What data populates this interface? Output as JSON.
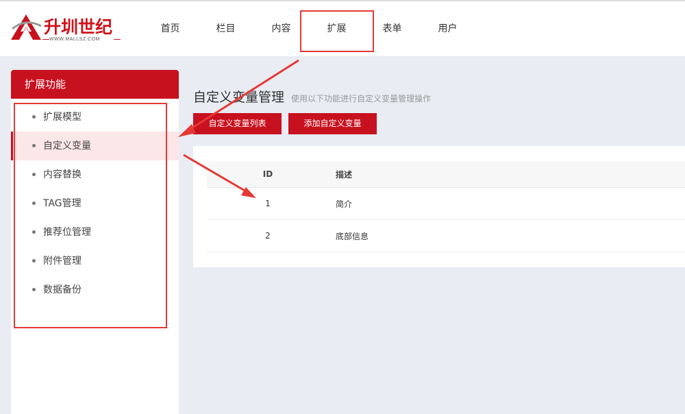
{
  "logo": {
    "title": "升圳世纪",
    "subtitle": "WWW.MALLSZ.COM"
  },
  "nav": {
    "items": [
      "首页",
      "栏目",
      "内容",
      "扩展",
      "表单",
      "用户"
    ],
    "active_index": 3
  },
  "sidebar": {
    "heading": "扩展功能",
    "items": [
      "扩展模型",
      "自定义变量",
      "内容替换",
      "TAG管理",
      "推荐位管理",
      "附件管理",
      "数据备份"
    ],
    "active_index": 1
  },
  "main": {
    "title": "自定义变量管理",
    "description": "使用以下功能进行自定义变量管理操作",
    "buttons": [
      "自定义变量列表",
      "添加自定义变量"
    ],
    "table": {
      "columns": [
        "ID",
        "描述"
      ],
      "rows": [
        [
          "1",
          "简介"
        ],
        [
          "2",
          "底部信息"
        ]
      ]
    }
  },
  "colors": {
    "brand": "#c8111f",
    "annotation": "#e53935",
    "background": "#e9ecf3"
  }
}
